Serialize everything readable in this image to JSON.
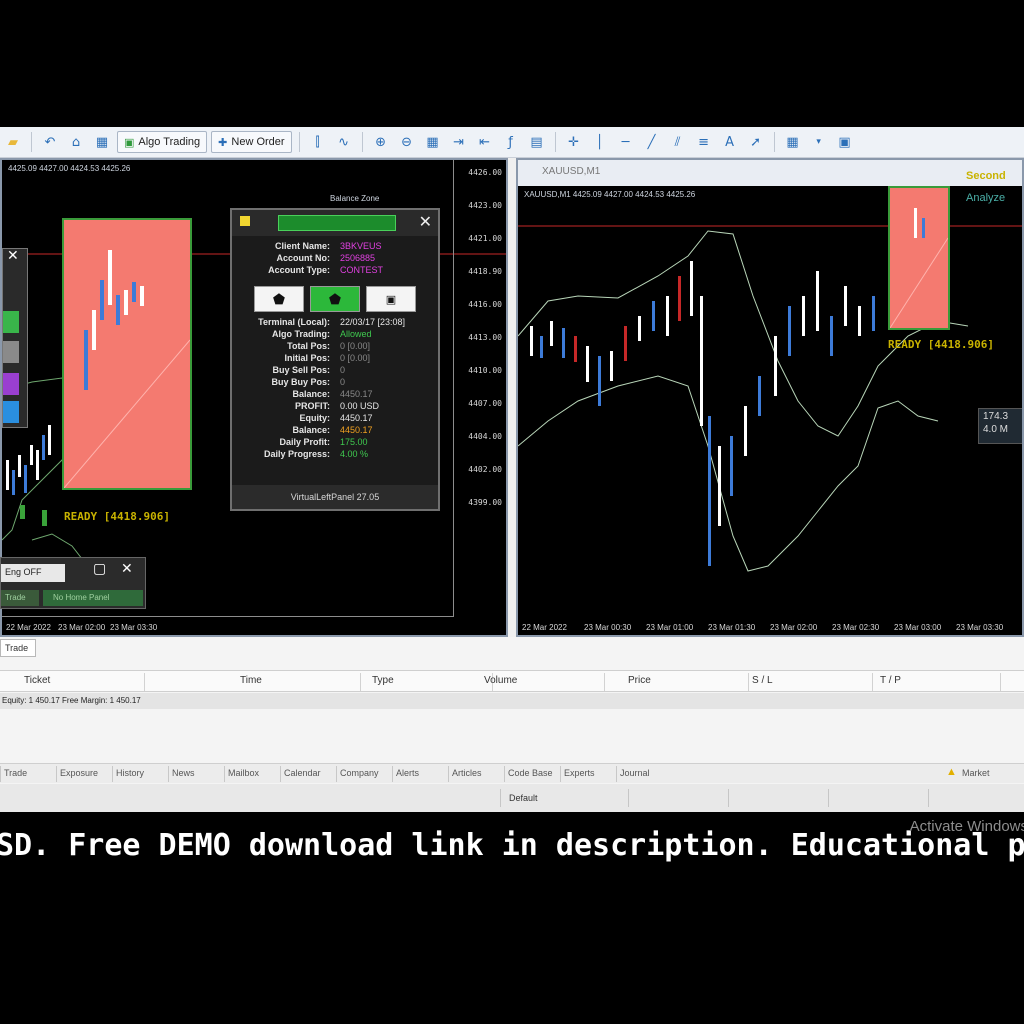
{
  "toolbar": {
    "algo_trading": "Algo Trading",
    "new_order": "New Order"
  },
  "left_chart": {
    "symbol_line": "4425.09 4427.00 4424.53 4425.26",
    "label_top_right": "Balance Zone",
    "status": "READY [4418.906]",
    "price_ticks": [
      "4426.00",
      "4423.00",
      "4421.00",
      "4418.90",
      "4416.00",
      "4413.00",
      "4410.00",
      "4407.00",
      "4404.00",
      "4402.00",
      "4399.00"
    ],
    "time_ticks": [
      "22 Mar 2022",
      "23 Mar 02:00",
      "23 Mar 03:30"
    ]
  },
  "info_panel": {
    "rows": [
      {
        "k": "Client Name:",
        "v": "3BKVEUS",
        "c": "#e040e0"
      },
      {
        "k": "Account No:",
        "v": "2506885",
        "c": "#e040e0"
      },
      {
        "k": "Account Type:",
        "v": "CONTEST",
        "c": "#e040e0"
      },
      {
        "k": "Terminal (Local):",
        "v": "22/03/17 [23:08]",
        "c": "#e6e6e6"
      },
      {
        "k": "Algo Trading:",
        "v": "Allowed",
        "c": "#3fc94f"
      },
      {
        "k": "Total Pos:",
        "v": "0 [0.00]",
        "c": "#888"
      },
      {
        "k": "Initial Pos:",
        "v": "0 [0.00]",
        "c": "#888"
      },
      {
        "k": "Buy Sell Pos:",
        "v": "0",
        "c": "#888"
      },
      {
        "k": "Buy Buy Pos:",
        "v": "0",
        "c": "#888"
      },
      {
        "k": "Balance:",
        "v": "4450.17",
        "c": "#888"
      },
      {
        "k": "PROFIT:",
        "v": "0.00 USD",
        "c": "#e6e6e6"
      },
      {
        "k": "Equity:",
        "v": "4450.17",
        "c": "#e6e6e6"
      },
      {
        "k": "Balance:",
        "v": "4450.17",
        "c": "#f0a020"
      },
      {
        "k": "Daily Profit:",
        "v": "175.00",
        "c": "#3fc94f"
      },
      {
        "k": "Daily Progress:",
        "v": "4.00 %",
        "c": "#3fc94f"
      }
    ],
    "footer": "VirtualLeftPanel 27.05"
  },
  "right_chart": {
    "window_title": "XAUUSD,M1",
    "symbol_line": "XAUUSD,M1  4425.09 4427.00 4424.53 4425.26",
    "status": "READY [4418.906]",
    "label_second": "Second",
    "label_analyze": "Analyze",
    "side_values": [
      "174.3",
      "4.0 M"
    ],
    "time_ticks": [
      "22 Mar 2022",
      "23 Mar 00:30",
      "23 Mar 01:00",
      "23 Mar 01:30",
      "23 Mar 02:00",
      "23 Mar 02:30",
      "23 Mar 03:00",
      "23 Mar 03:30"
    ]
  },
  "bottom_mini": {
    "toggle": "Eng OFF",
    "left_btn": "Trade",
    "right_btn": "No Home Panel"
  },
  "terminal": {
    "tab": "Trade",
    "columns": [
      "Ticket",
      "Time",
      "Type",
      "Volume",
      "Price",
      "S / L",
      "T / P"
    ],
    "equity_line": "Equity: 1 450.17  Free Margin: 1 450.17",
    "tabs": [
      "Trade",
      "Exposure",
      "History",
      "News",
      "Mailbox",
      "Calendar",
      "Company",
      "Alerts",
      "Articles",
      "Code Base",
      "Experts",
      "Journal"
    ],
    "market_label": "Market",
    "status_default": "Default"
  },
  "caption": "SD. Free DEMO download link in description. Educational purp",
  "watermark": "Activate Windows"
}
